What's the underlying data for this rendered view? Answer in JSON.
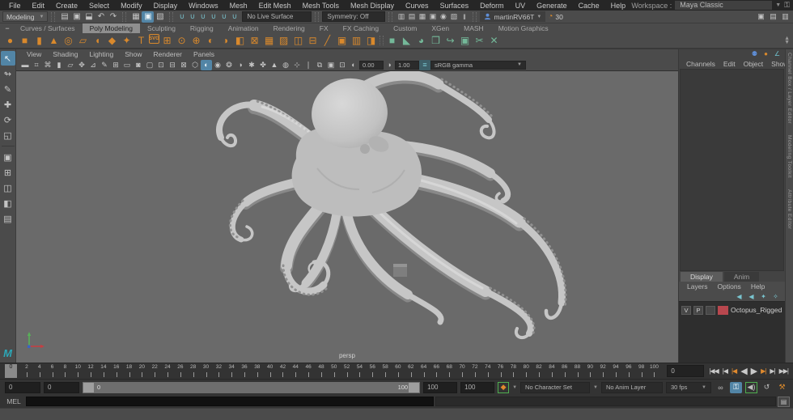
{
  "menu_bar": {
    "items": [
      "File",
      "Edit",
      "Create",
      "Select",
      "Modify",
      "Display",
      "Windows",
      "Mesh",
      "Edit Mesh",
      "Mesh Tools",
      "Mesh Display",
      "Curves",
      "Surfaces",
      "Deform",
      "UV",
      "Generate",
      "Cache",
      "Help"
    ],
    "workspace_label": "Workspace :",
    "workspace_value": "Maya Classic"
  },
  "status_line": {
    "menuset": "Modeling",
    "live_surface": "No Live Surface",
    "symmetry": "Symmetry: Off",
    "user": "martinRV66T",
    "clock_value": "30",
    "file_icons": [
      {
        "n": "new-scene-icon",
        "g": "▤"
      },
      {
        "n": "open-scene-icon",
        "g": "▣"
      },
      {
        "n": "save-scene-icon",
        "g": "⬓"
      },
      {
        "n": "undo-icon",
        "g": "↶"
      },
      {
        "n": "redo-icon",
        "g": "↷"
      }
    ],
    "select_icons": [
      {
        "n": "select-hierarchy-icon",
        "g": "▦",
        "active": false
      },
      {
        "n": "select-object-icon",
        "g": "▣",
        "active": true
      },
      {
        "n": "select-component-icon",
        "g": "▧",
        "active": false
      }
    ],
    "snap_icons": [
      {
        "n": "snap-grid-icon",
        "g": "∪"
      },
      {
        "n": "snap-curve-icon",
        "g": "∪"
      },
      {
        "n": "snap-point-icon",
        "g": "∪"
      },
      {
        "n": "snap-projected-center-icon",
        "g": "∪"
      },
      {
        "n": "snap-view-plane-icon",
        "g": "∪"
      },
      {
        "n": "make-live-icon",
        "g": "∪"
      }
    ],
    "render_icons": [
      {
        "n": "render-view-icon",
        "g": "▥"
      },
      {
        "n": "render-current-icon",
        "g": "▤"
      },
      {
        "n": "ipr-render-icon",
        "g": "▦"
      },
      {
        "n": "render-settings-icon",
        "g": "▣"
      },
      {
        "n": "hypershade-icon",
        "g": "◉"
      },
      {
        "n": "light-editor-icon",
        "g": "▧"
      },
      {
        "n": "paused-viewport-icon",
        "g": "‖"
      }
    ],
    "sidebar_toggle_icons": [
      {
        "n": "modeling-toolkit-toggle-icon",
        "g": "▣"
      },
      {
        "n": "attribute-editor-toggle-icon",
        "g": "▤"
      },
      {
        "n": "channel-box-toggle-icon",
        "g": "▥"
      }
    ]
  },
  "shelf": {
    "tabs": [
      {
        "label": "Curves / Surfaces",
        "active": false
      },
      {
        "label": "Poly Modeling",
        "active": true
      },
      {
        "label": "Sculpting",
        "active": false
      },
      {
        "label": "Rigging",
        "active": false
      },
      {
        "label": "Animation",
        "active": false
      },
      {
        "label": "Rendering",
        "active": false
      },
      {
        "label": "FX",
        "active": false
      },
      {
        "label": "FX Caching",
        "active": false
      },
      {
        "label": "Custom",
        "active": false
      },
      {
        "label": "XGen",
        "active": false
      },
      {
        "label": "MASH",
        "active": false
      },
      {
        "label": "Motion Graphics",
        "active": false
      }
    ],
    "collapse_glyph": "−",
    "icons_primary": [
      {
        "n": "poly-sphere-icon",
        "g": "●"
      },
      {
        "n": "poly-cube-icon",
        "g": "■"
      },
      {
        "n": "poly-cylinder-icon",
        "g": "▮"
      },
      {
        "n": "poly-cone-icon",
        "g": "▲"
      },
      {
        "n": "poly-torus-icon",
        "g": "◎"
      },
      {
        "n": "poly-plane-icon",
        "g": "▱"
      },
      {
        "n": "poly-disc-icon",
        "g": "◖"
      },
      {
        "n": "platonic-solid-icon",
        "g": "◆"
      },
      {
        "n": "super-shape-icon",
        "g": "✦"
      },
      {
        "n": "type-tool-icon",
        "g": "T"
      },
      {
        "n": "svg-tool-icon",
        "g": "SVG",
        "svg_text": true
      },
      {
        "n": "construction-plane-icon",
        "g": "⊞"
      },
      {
        "n": "free-point-icon",
        "g": "⊙"
      },
      {
        "n": "origin-locator-icon",
        "g": "⊕"
      },
      {
        "n": "combine-icon",
        "g": "◐"
      },
      {
        "n": "separate-icon",
        "g": "◑"
      },
      {
        "n": "extract-icon",
        "g": "◧"
      },
      {
        "n": "boolean-union-icon",
        "g": "⊠"
      },
      {
        "n": "smooth-icon",
        "g": "▦"
      },
      {
        "n": "reduce-icon",
        "g": "▨"
      },
      {
        "n": "mirror-icon",
        "g": "◫"
      },
      {
        "n": "bridge-icon",
        "g": "⊟"
      },
      {
        "n": "multi-cut-icon",
        "g": "╱"
      },
      {
        "n": "quad-draw-icon",
        "g": "▣"
      },
      {
        "n": "insert-edge-loop-icon",
        "g": "▥"
      },
      {
        "n": "bevel-icon",
        "g": "◨"
      }
    ],
    "icons_secondary": [
      {
        "n": "quadrangulate-icon",
        "g": "■"
      },
      {
        "n": "triangulate-icon",
        "g": "◣"
      },
      {
        "n": "fill-hole-icon",
        "g": "◕"
      },
      {
        "n": "cleanup-icon",
        "g": "❒"
      },
      {
        "n": "curve-warp-icon",
        "g": "↪"
      },
      {
        "n": "transfer-attributes-icon",
        "g": "▣"
      },
      {
        "n": "average-vertices-icon",
        "g": "✂"
      },
      {
        "n": "delete-history-icon",
        "g": "✕"
      }
    ]
  },
  "toolbox": {
    "tools": [
      {
        "n": "select-tool",
        "g": "↖",
        "active": true
      },
      {
        "n": "lasso-tool",
        "g": "↬",
        "active": false
      },
      {
        "n": "paint-select-tool",
        "g": "✎",
        "active": false
      },
      {
        "n": "move-tool",
        "g": "✚",
        "active": false
      },
      {
        "n": "rotate-tool",
        "g": "⟳",
        "active": false
      },
      {
        "n": "scale-tool",
        "g": "◱",
        "active": false
      }
    ],
    "layouts": [
      {
        "n": "layout-single-pane",
        "g": "▣"
      },
      {
        "n": "layout-four-pane",
        "g": "⊞"
      },
      {
        "n": "layout-two-pane",
        "g": "◫"
      },
      {
        "n": "layout-persp-outliner",
        "g": "◧"
      },
      {
        "n": "layout-outliner",
        "g": "▤"
      }
    ]
  },
  "viewport": {
    "menus": [
      "View",
      "Shading",
      "Lighting",
      "Show",
      "Renderer",
      "Panels"
    ],
    "toolbar_icons": [
      {
        "n": "select-camera-icon",
        "g": "▬"
      },
      {
        "n": "lock-camera-icon",
        "g": "⌗"
      },
      {
        "n": "camera-attrs-icon",
        "g": "⌘"
      },
      {
        "n": "bookmark-icon",
        "g": "▮"
      },
      {
        "n": "image-plane-icon",
        "g": "▱"
      },
      {
        "n": "2d-pan-zoom-icon",
        "g": "✥"
      },
      {
        "n": "overscan-icon",
        "g": "⊿"
      },
      {
        "n": "grease-pencil-icon",
        "g": "✎"
      },
      {
        "n": "grid-icon",
        "g": "⊞",
        "boxed": true
      },
      {
        "n": "film-gate-icon",
        "g": "▭",
        "boxed": true
      },
      {
        "n": "resolution-gate-icon",
        "g": "◙",
        "boxed": true
      },
      {
        "n": "gate-mask-icon",
        "g": "▢",
        "boxed": true
      },
      {
        "n": "field-chart-icon",
        "g": "⊡",
        "boxed": true
      },
      {
        "n": "safe-action-icon",
        "g": "⊟",
        "boxed": true
      },
      {
        "n": "safe-title-icon",
        "g": "⊠",
        "boxed": true
      },
      {
        "n": "wireframe-icon",
        "g": "⬡"
      },
      {
        "n": "shaded-icon",
        "g": "◐",
        "active": true
      },
      {
        "n": "textured-icon",
        "g": "◉"
      },
      {
        "n": "use-all-lights-icon",
        "g": "❂"
      },
      {
        "n": "shadows-icon",
        "g": "◑"
      },
      {
        "n": "screen-space-ao-icon",
        "g": "✱"
      },
      {
        "n": "motion-blur-icon",
        "g": "✤"
      },
      {
        "n": "anti-alias-icon",
        "g": "▲"
      },
      {
        "n": "xray-icon",
        "g": "◍"
      },
      {
        "n": "isolate-select-icon",
        "g": "⊹"
      },
      {
        "n": "separator-icon",
        "g": "❘"
      },
      {
        "n": "viewport-renderer-icon",
        "g": "⧉"
      },
      {
        "n": "sequence-time-icon",
        "g": "▣"
      },
      {
        "n": "snapshot-icon",
        "g": "⊡"
      }
    ],
    "exposure_icon": "◐",
    "exposure": "0.00",
    "gamma_icon": "◑",
    "gamma": "1.00",
    "color_transform_icon": "≡",
    "color_transform": "sRGB gamma",
    "camera_label": "persp"
  },
  "channel_box": {
    "head_icons": [
      {
        "n": "workspace-user-icon",
        "g": "⚉",
        "c": "#5f8fd9"
      },
      {
        "n": "color-managed-icon",
        "g": "●",
        "c": "#d9892c"
      },
      {
        "n": "graph-icon",
        "g": "∠",
        "c": "#6fc2cf"
      }
    ],
    "menus": [
      "Channels",
      "Edit",
      "Object",
      "Show"
    ],
    "side_tabs": [
      "Channel Box / Layer Editor",
      "Modeling Toolkit",
      "Attribute Editor"
    ]
  },
  "layer_editor": {
    "tabs": [
      {
        "label": "Display",
        "active": true
      },
      {
        "label": "Anim",
        "active": false
      }
    ],
    "menus": [
      "Layers",
      "Options",
      "Help"
    ],
    "row_icons": [
      {
        "n": "move-layer-up-icon",
        "g": "◀"
      },
      {
        "n": "move-layer-down-icon",
        "g": "◀"
      },
      {
        "n": "new-empty-layer-icon",
        "g": "✦"
      },
      {
        "n": "new-layer-selected-icon",
        "g": "✧"
      }
    ],
    "layers": [
      {
        "visible": "V",
        "playback": "P",
        "extra": "",
        "color": "#b8474e",
        "name": "Octopus_Rigged"
      }
    ]
  },
  "timeline": {
    "current_frame": "0",
    "tick_labels": [
      2,
      4,
      6,
      8,
      10,
      12,
      14,
      16,
      18,
      20,
      22,
      24,
      26,
      28,
      30,
      32,
      34,
      36,
      38,
      40,
      42,
      44,
      46,
      48,
      50,
      52,
      54,
      56,
      58,
      60,
      62,
      64,
      66,
      68,
      70,
      72,
      74,
      76,
      78,
      80,
      82,
      84,
      86,
      88,
      90,
      92,
      94,
      96,
      98,
      100
    ],
    "frame_field": "0",
    "playback_buttons": [
      {
        "n": "go-to-start-button",
        "g": "|◀◀",
        "key": false
      },
      {
        "n": "step-back-frame-button",
        "g": "|◀",
        "key": false
      },
      {
        "n": "step-back-key-button",
        "g": "|◀",
        "key": true
      },
      {
        "n": "play-backwards-button",
        "g": "◀",
        "key": false,
        "big": true
      },
      {
        "n": "play-forwards-button",
        "g": "▶",
        "key": false,
        "big": true
      },
      {
        "n": "step-forward-key-button",
        "g": "▶|",
        "key": true
      },
      {
        "n": "step-forward-frame-button",
        "g": "▶|",
        "key": false
      },
      {
        "n": "go-to-end-button",
        "g": "▶▶|",
        "key": false
      }
    ]
  },
  "range_slider": {
    "animation_start": "0",
    "playback_start": "0",
    "handle_left": "0",
    "handle_right": "100",
    "playback_end": "100",
    "animation_end": "100",
    "character_set": "No Character Set",
    "anim_layer": "No Anim Layer",
    "fps": "30 fps",
    "key_glyph": "◆",
    "loop_glyph": "∞",
    "autokey_glyph": "⚿",
    "sound_glyph": "◀)",
    "cache_glyph": "↺",
    "prefs_glyph": "⚒"
  },
  "command_line": {
    "label": "MEL",
    "script_editor_glyph": "▤"
  },
  "colors": {
    "accent_orange": "#d9892c",
    "accent_green": "#74b899",
    "accent_teal": "#6fc2cf",
    "selection_blue": "#5285a6",
    "layer_red": "#b8474e",
    "axis_x_red": "#c34043",
    "axis_y_green": "#58b158",
    "axis_z_blue": "#3b63c3"
  }
}
